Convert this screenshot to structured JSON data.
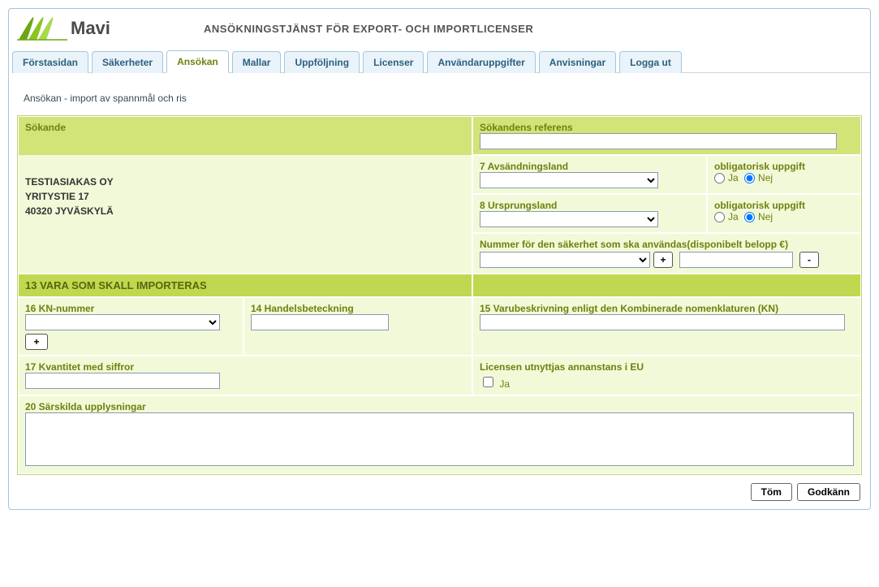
{
  "brand": "Mavi",
  "page_title": "ANSÖKNINGSTJÄNST FÖR EXPORT- OCH IMPORTLICENSER",
  "tabs": [
    {
      "label": "Förstasidan"
    },
    {
      "label": "Säkerheter"
    },
    {
      "label": "Ansökan"
    },
    {
      "label": "Mallar"
    },
    {
      "label": "Uppföljning"
    },
    {
      "label": "Licenser"
    },
    {
      "label": "Användaruppgifter"
    },
    {
      "label": "Anvisningar"
    },
    {
      "label": "Logga ut"
    }
  ],
  "subtitle": "Ansökan - import av spannmål och ris",
  "applicant": {
    "heading": "Sökande",
    "name": "TESTIASIAKAS OY",
    "street": "YRITYSTIE 17",
    "city": "40320  JYVÄSKYLÄ"
  },
  "reference": {
    "heading": "Sökandens referens",
    "value": ""
  },
  "field7": {
    "label": "7 Avsändningsland",
    "value": "",
    "mandatory_label": "obligatorisk uppgift",
    "ja": "Ja",
    "nej": "Nej",
    "selected": "Nej"
  },
  "field8": {
    "label": "8 Ursprungsland",
    "value": "",
    "mandatory_label": "obligatorisk uppgift",
    "ja": "Ja",
    "nej": "Nej",
    "selected": "Nej"
  },
  "security": {
    "label": "Nummer för den säkerhet som ska användas(disponibelt belopp €)",
    "dropdown_value": "",
    "plus": "+",
    "minus": "-",
    "amount": ""
  },
  "section13": "13 VARA SOM SKALL IMPORTERAS",
  "field16": {
    "label": "16 KN-nummer",
    "value": "",
    "plus": "+"
  },
  "field14": {
    "label": "14 Handelsbeteckning",
    "value": ""
  },
  "field15": {
    "label": "15 Varubeskrivning enligt den Kombinerade nomenklaturen (KN)",
    "value": ""
  },
  "field17": {
    "label": "17 Kvantitet med siffror",
    "value": ""
  },
  "license_eu": {
    "label": "Licensen utnyttjas annanstans i EU",
    "checkbox_label": "Ja",
    "checked": false
  },
  "field20": {
    "label": "20 Särskilda upplysningar",
    "value": ""
  },
  "footer": {
    "tom": "Töm",
    "godkann": "Godkänn"
  }
}
